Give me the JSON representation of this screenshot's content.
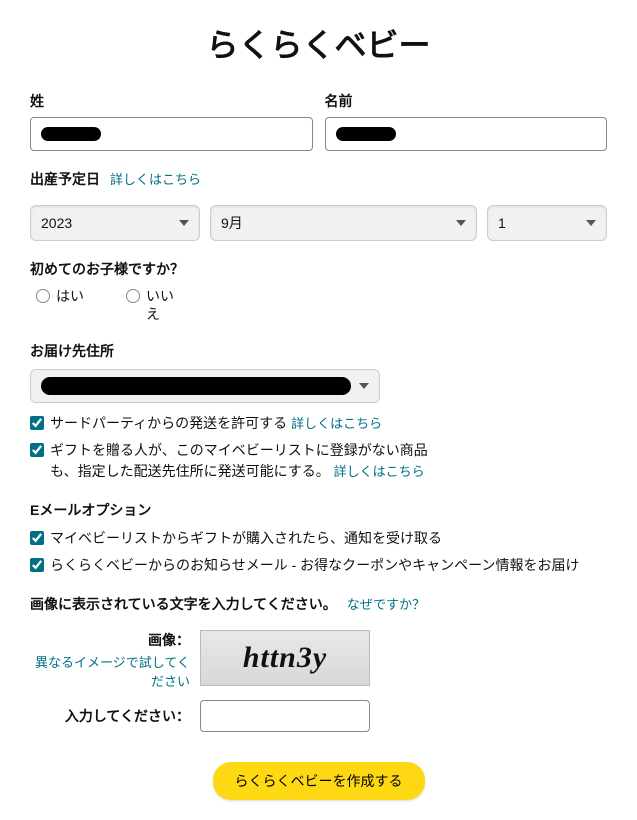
{
  "title": "らくらくベビー",
  "name": {
    "last_label": "姓",
    "first_label": "名前"
  },
  "due": {
    "label": "出産予定日",
    "more_link": "詳しくはこちら",
    "year": "2023",
    "month": "9月",
    "day": "1"
  },
  "first_child": {
    "label": "初めてのお子様ですか？",
    "yes": "はい",
    "no": "いいえ"
  },
  "address": {
    "label": "お届け先住所",
    "opt1_text": "サードパーティからの発送を許可する",
    "opt1_link": "詳しくはこちら",
    "opt2_text": "ギフトを贈る人が、このマイベビーリストに登録がない商品も、指定した配送先住所に発送可能にする。",
    "opt2_link": "詳しくはこちら"
  },
  "email": {
    "label": "Eメールオプション",
    "opt1": "マイベビーリストからギフトが購入されたら、通知を受け取る",
    "opt2": "らくらくベビーからのお知らせメール - お得なクーポンやキャンペーン情報をお届け"
  },
  "captcha": {
    "prompt": "画像に表示されている文字を入力してください。",
    "why_link": "なぜですか？",
    "image_label": "画像：",
    "refresh_link": "異なるイメージで試してください",
    "image_text": "httn3y",
    "input_label": "入力してください："
  },
  "submit": "らくらくベビーを作成する"
}
